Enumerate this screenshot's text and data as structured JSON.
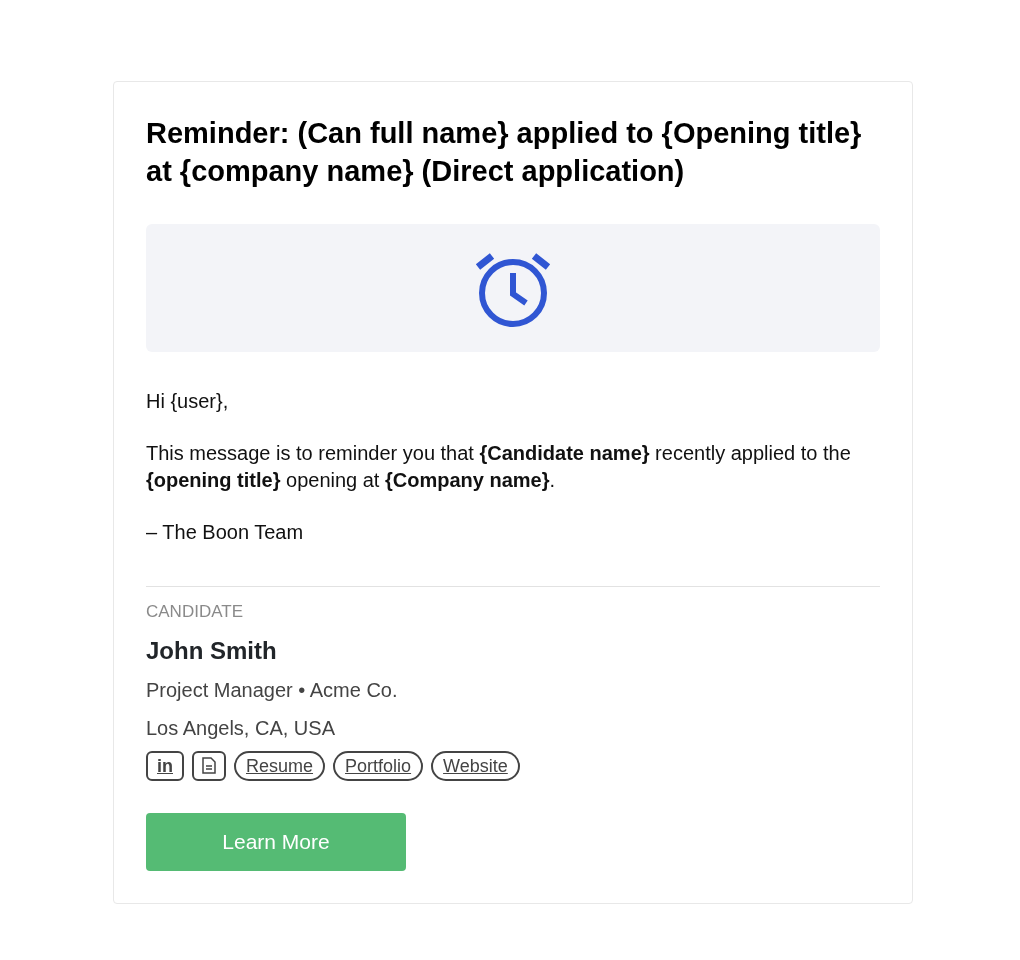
{
  "email": {
    "title": "Reminder: (Can full name} applied to {Opening title} at {company name} (Direct application)",
    "greeting": "Hi {user},",
    "message": "This message is to reminder you that **{Candidate name}** recently applied to the **{opening title}** opening at **{Company name}**.",
    "signoff": "– The Boon Team"
  },
  "candidate": {
    "section_label": "CANDIDATE",
    "name": "John Smith",
    "role": "Project Manager • Acme Co.",
    "location": "Los Angels, CA, USA",
    "links": [
      {
        "kind": "square",
        "label": "in"
      },
      {
        "kind": "icon"
      },
      {
        "kind": "pill",
        "label": "Resume"
      },
      {
        "kind": "pill",
        "label": "Portfolio"
      },
      {
        "kind": "pill",
        "label": "Website"
      }
    ]
  },
  "button": "Learn More"
}
